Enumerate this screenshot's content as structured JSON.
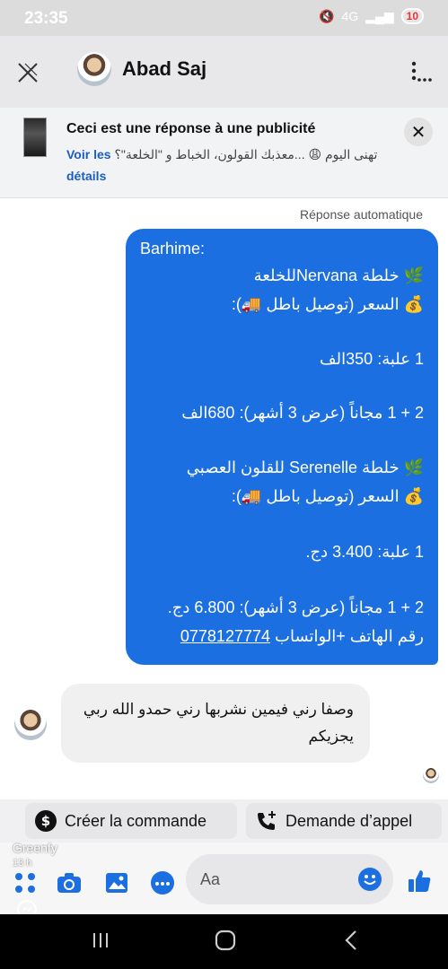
{
  "status": {
    "time": "23:35",
    "battery": "10",
    "signal": "4G"
  },
  "header": {
    "name": "Abad Saj"
  },
  "ad": {
    "title": "Ceci est une réponse à une publicité",
    "snippet": "تهنى اليوم 😩 ...معذبك القولون، الخباط و \"الخلعة\"؟",
    "link": "Voir les détails"
  },
  "chat": {
    "auto_label": "Réponse automatique",
    "reply_lines": [
      "Barhime:",
      "🌿 خلطة Nervanaللخلعة",
      "💰 السعر (توصيل باطل 🚚):",
      "1 علبة: 350الف",
      "2 + 1 مجاناً (عرض 3 أشهر): 680الف",
      "🌿 خلطة Serenelle للقلون العصبي",
      "💰 السعر (توصيل باطل 🚚):",
      "1 علبة: 3.400 دج.",
      "2 + 1 مجاناً (عرض 3 أشهر): 6.800 دج.",
      "رقم الهاتف +الواتساب"
    ],
    "phone": "0778127774",
    "incoming": "وصفا رني فيمين نشربها رني حمدو الله ربي يجزيكم"
  },
  "actions": {
    "order": "Créer la commande",
    "call": "Demande d’appel"
  },
  "watermark": {
    "brand": "Greenfy",
    "time": "13 h"
  },
  "composer": {
    "placeholder": "Aa"
  },
  "colors": {
    "accent": "#1c6fe0",
    "header_bg": "#e8e8ea"
  }
}
